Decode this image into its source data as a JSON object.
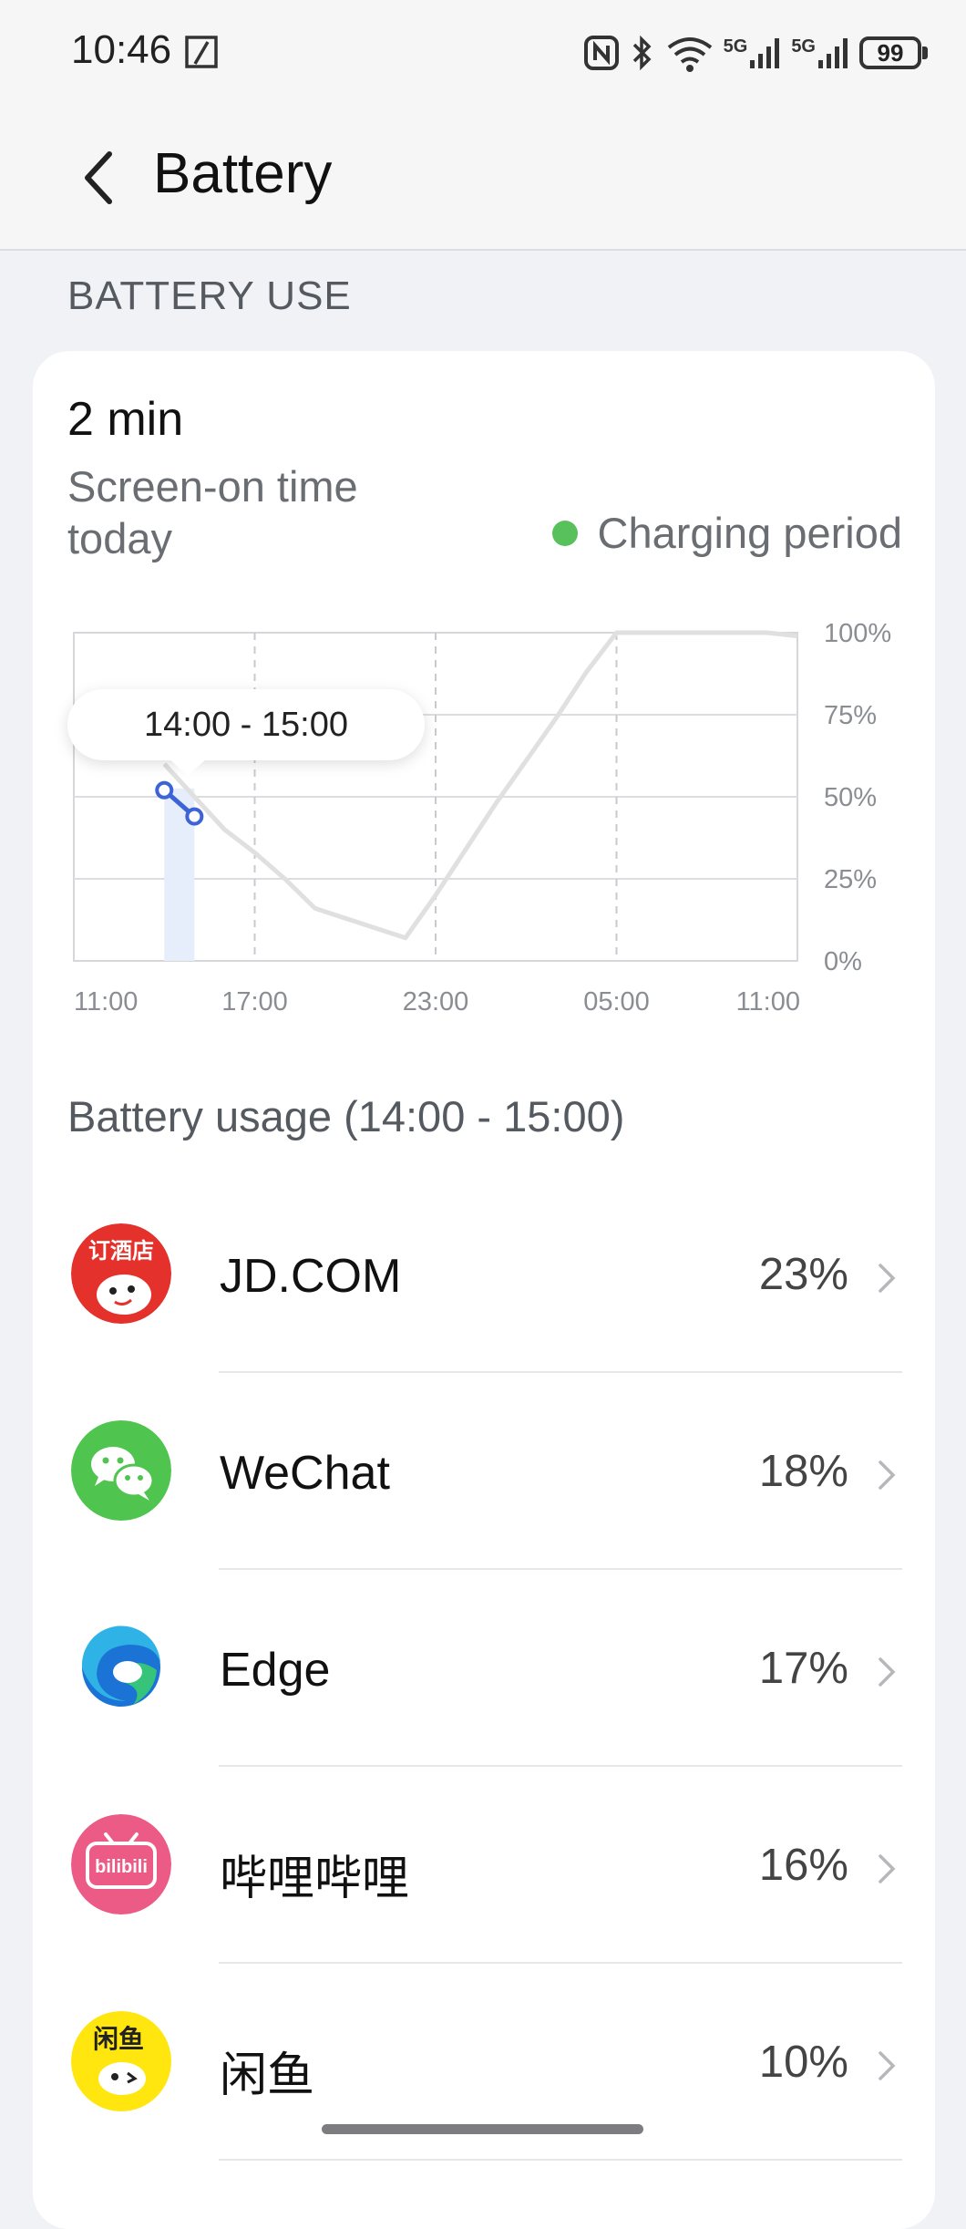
{
  "status_bar": {
    "time": "10:46",
    "battery": "99",
    "network_1": "5G",
    "network_2": "5G"
  },
  "header": {
    "title": "Battery"
  },
  "section_label": "BATTERY USE",
  "summary": {
    "screen_on_value": "2 min",
    "screen_on_label": "Screen-on time today",
    "legend_label": "Charging period",
    "legend_color": "#58c15b"
  },
  "chart_data": {
    "type": "line",
    "x_ticks": [
      "11:00",
      "17:00",
      "23:00",
      "05:00",
      "11:00"
    ],
    "y_ticks": [
      "100%",
      "75%",
      "50%",
      "25%",
      "0%"
    ],
    "ylim": [
      0,
      100
    ],
    "series": [
      {
        "points": [
          {
            "t": 3,
            "v": 60
          },
          {
            "t": 4,
            "v": 50
          },
          {
            "t": 5,
            "v": 40
          },
          {
            "t": 6,
            "v": 33
          },
          {
            "t": 7,
            "v": 25
          },
          {
            "t": 8,
            "v": 16
          },
          {
            "t": 9,
            "v": 13
          },
          {
            "t": 10,
            "v": 10
          },
          {
            "t": 11,
            "v": 7
          },
          {
            "t": 12,
            "v": 20
          },
          {
            "t": 13,
            "v": 34
          },
          {
            "t": 14,
            "v": 48
          },
          {
            "t": 15,
            "v": 61
          },
          {
            "t": 16,
            "v": 74
          },
          {
            "t": 17,
            "v": 88
          },
          {
            "t": 18,
            "v": 100
          },
          {
            "t": 19,
            "v": 100
          },
          {
            "t": 20,
            "v": 100
          },
          {
            "t": 21,
            "v": 100
          },
          {
            "t": 22,
            "v": 100
          },
          {
            "t": 23,
            "v": 100
          },
          {
            "t": 24,
            "v": 99
          }
        ],
        "color": "#e0e0e0"
      }
    ],
    "highlight": {
      "range": "14:00 - 15:00",
      "points": [
        {
          "t": 3,
          "v": 52
        },
        {
          "t": 4,
          "v": 44
        }
      ],
      "color": "#3d63d7"
    },
    "grid": true
  },
  "tooltip": {
    "text": "14:00 - 15:00"
  },
  "usage_title": "Battery usage (14:00 - 15:00)",
  "apps": [
    {
      "name": "JD.COM",
      "percent": "23%",
      "icon_label": "订酒店",
      "icon": "jd-icon"
    },
    {
      "name": "WeChat",
      "percent": "18%",
      "icon": "wechat-icon"
    },
    {
      "name": "Edge",
      "percent": "17%",
      "icon": "edge-icon"
    },
    {
      "name": "哔哩哔哩",
      "percent": "16%",
      "icon_label": "bilibili",
      "icon": "bilibili-icon"
    },
    {
      "name": "闲鱼",
      "percent": "10%",
      "icon_label": "闲鱼",
      "icon": "xianyu-icon"
    }
  ]
}
